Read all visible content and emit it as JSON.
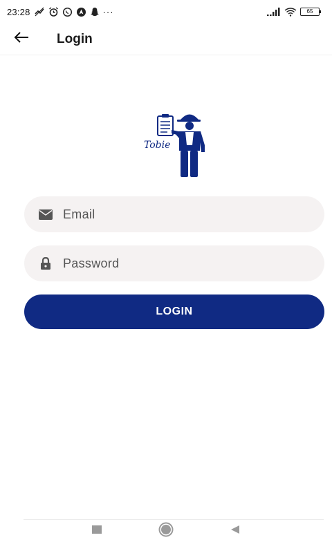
{
  "status_bar": {
    "time": "23:28",
    "more": "···",
    "battery": "65"
  },
  "app_bar": {
    "title": "Login"
  },
  "logo": {
    "text": "Tobie",
    "color": "#102a83"
  },
  "form": {
    "email_placeholder": "Email",
    "password_placeholder": "Password",
    "login_label": "LOGIN"
  },
  "colors": {
    "accent": "#102a83",
    "field_bg": "#f5f2f2"
  },
  "nav": {
    "icons": [
      "recents-square-icon",
      "home-circle-icon",
      "back-triangle-icon"
    ]
  }
}
